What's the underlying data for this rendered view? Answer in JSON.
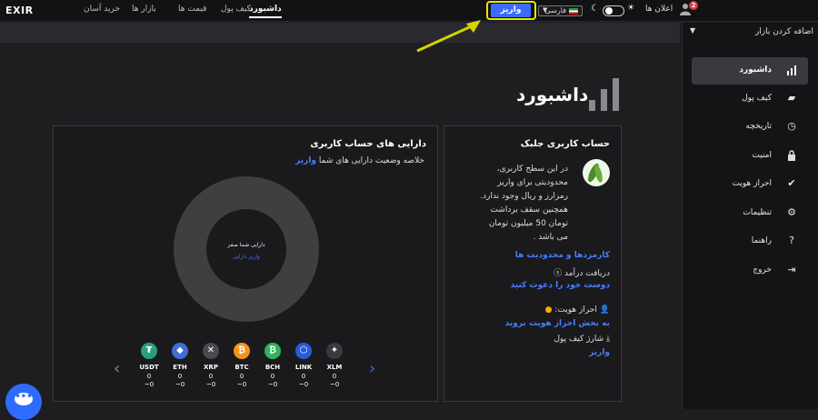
{
  "header": {
    "logo": "EXIR",
    "nav": [
      "خرید آسان",
      "بازار ها",
      "قیمت ها",
      "کیف پول",
      "داشبورد"
    ],
    "active_nav": "داشبورد",
    "deposit_label": "واریز",
    "language": "فارسی",
    "announcements_label": "اعلان ها",
    "notifications_count": "2"
  },
  "sidebar": {
    "add_market_label": "اضافه کردن بازار",
    "items": [
      {
        "label": "داشبورد",
        "icon": "bar-chart-icon"
      },
      {
        "label": "کیف پول",
        "icon": "wallet-icon"
      },
      {
        "label": "تاریخچه",
        "icon": "clock-icon"
      },
      {
        "label": "امنیت",
        "icon": "lock-icon"
      },
      {
        "label": "احراز هویت",
        "icon": "check-circle-icon"
      },
      {
        "label": "تنظیمات",
        "icon": "gear-icon"
      },
      {
        "label": "راهنما",
        "icon": "help-icon"
      },
      {
        "label": "خروج",
        "icon": "logout-icon"
      }
    ]
  },
  "page": {
    "title": "داشبورد"
  },
  "assets_card": {
    "title": "دارایی های حساب کاربری",
    "subtitle": "خلاصه وضعیت دارایی های شما",
    "subtitle_link": "واریز",
    "donut_text": "دارایی شما صفر",
    "donut_link": "واریز دارایی",
    "coins": [
      {
        "symbol": "USDT",
        "v1": "0",
        "v2": "~0",
        "color": "#26a17b",
        "glyph": "₮"
      },
      {
        "symbol": "ETH",
        "v1": "0",
        "v2": "~0",
        "color": "#3c6fd6",
        "glyph": "◆"
      },
      {
        "symbol": "XRP",
        "v1": "0",
        "v2": "~0",
        "color": "#4a4a4e",
        "glyph": "✕"
      },
      {
        "symbol": "BTC",
        "v1": "0",
        "v2": "~0",
        "color": "#f7931a",
        "glyph": "₿"
      },
      {
        "symbol": "BCH",
        "v1": "0",
        "v2": "~0",
        "color": "#30b25a",
        "glyph": "₿"
      },
      {
        "symbol": "LINK",
        "v1": "0",
        "v2": "~0",
        "color": "#2a5ada",
        "glyph": "⬡"
      },
      {
        "symbol": "XLM",
        "v1": "0",
        "v2": "~0",
        "color": "#3a3a3e",
        "glyph": "✦"
      }
    ]
  },
  "user_card": {
    "title": "حساب کاربری جلبک",
    "description": [
      "در این سطح کاربری،",
      "محدودیتی برای واریز",
      "رمزارز و ریال وجود ندارد.",
      "همچنین سقف برداشت",
      "تومان 50 میلیون تومان",
      "می باشد ."
    ],
    "fees_link": "کارمزدها و محدودیت ها",
    "earn_label": "دریافت درآمد",
    "invite_link": "دوست خود را دعوت کنید",
    "kyc_label": "احراز هویت:",
    "kyc_link": "به بخش احراز هویت بروید",
    "wallet_charge_label": "شارژ کیف پول",
    "wallet_charge_link": "واریز"
  }
}
